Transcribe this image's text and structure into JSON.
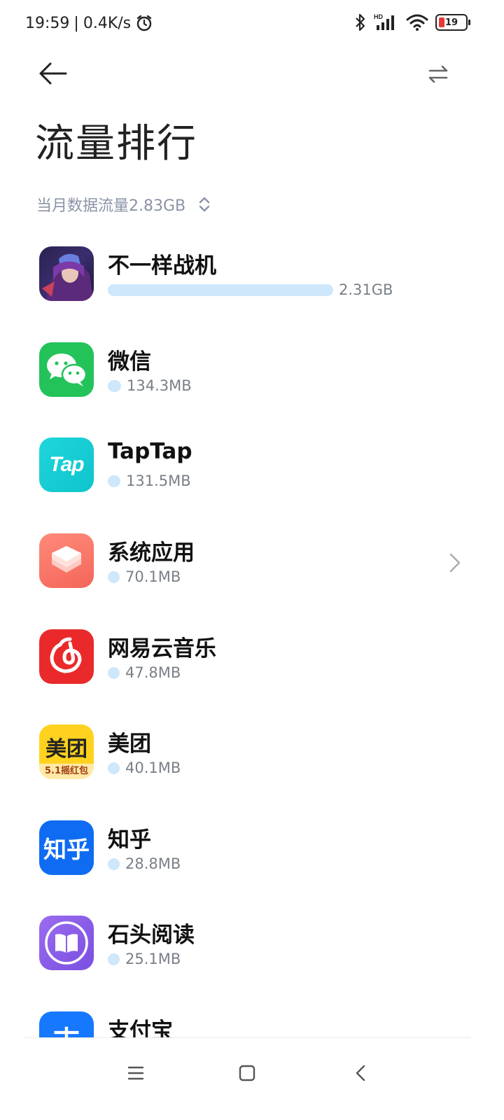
{
  "status_bar": {
    "time": "19:59",
    "net_speed": "0.4K/s",
    "alarm_icon": "alarm-icon",
    "bluetooth_icon": "bluetooth-icon",
    "signal_label": "HD",
    "wifi_icon": "wifi-icon",
    "battery_level": "19",
    "battery_color": "#e53935"
  },
  "header": {
    "back_icon": "back-arrow-icon",
    "swap_icon": "swap-arrows-icon",
    "title": "流量排行",
    "summary": "当月数据流量2.83GB",
    "summary_icon": "sort-updown-icon"
  },
  "apps": [
    {
      "name": "不一样战机",
      "usage": "2.31GB",
      "share": 1.0,
      "icon": "game-avatar-icon",
      "has_chevron": false
    },
    {
      "name": "微信",
      "usage": "134.3MB",
      "share": 0.058,
      "icon": "wechat-icon",
      "has_chevron": false
    },
    {
      "name": "TapTap",
      "usage": "131.5MB",
      "share": 0.057,
      "icon": "taptap-icon",
      "icon_text": "Tap",
      "has_chevron": false
    },
    {
      "name": "系统应用",
      "usage": "70.1MB",
      "share": 0.03,
      "icon": "system-apps-icon",
      "has_chevron": true
    },
    {
      "name": "网易云音乐",
      "usage": "47.8MB",
      "share": 0.02,
      "icon": "netease-music-icon",
      "has_chevron": false
    },
    {
      "name": "美团",
      "usage": "40.1MB",
      "share": 0.017,
      "icon": "meituan-icon",
      "icon_text": "美团",
      "icon_subtext": "5.1摇红包",
      "has_chevron": false
    },
    {
      "name": "知乎",
      "usage": "28.8MB",
      "share": 0.012,
      "icon": "zhihu-icon",
      "icon_text": "知乎",
      "has_chevron": false
    },
    {
      "name": "石头阅读",
      "usage": "25.1MB",
      "share": 0.011,
      "icon": "book-reader-icon",
      "has_chevron": false
    },
    {
      "name": "支付宝",
      "usage": "",
      "share": 0,
      "icon": "alipay-icon",
      "icon_text": "支",
      "has_chevron": false
    }
  ],
  "nav": {
    "menu_icon": "menu-icon",
    "home_icon": "home-icon",
    "back_icon": "nav-back-icon"
  }
}
